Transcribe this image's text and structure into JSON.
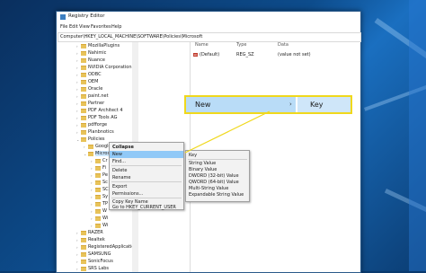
{
  "window": {
    "title": "Registry Editor"
  },
  "menu": [
    "File",
    "Edit",
    "View",
    "Favorites",
    "Help"
  ],
  "address": "Computer\\HKEY_LOCAL_MACHINE\\SOFTWARE\\Policies\\Microsoft",
  "tree": [
    "MozillaPlugins",
    "Nahimic",
    "Nuance",
    "NVIDIA Corporation",
    "ODBC",
    "OEM",
    "Oracle",
    "paint.net",
    "Partner",
    "PDF Architect 4",
    "PDF Tools AG",
    "pdfforge",
    "Planbnotics",
    "Policies",
    "Google",
    "Microsoft"
  ],
  "tree_after": [
    "RAZER",
    "Realtek",
    "RegisteredApplication",
    "SAMSUNG",
    "SonicFocus",
    "SRS Labs"
  ],
  "tree_children_partial": [
    "Cr",
    "Fi",
    "Pe",
    "Sc",
    "SC",
    "Sy",
    "TP",
    "W",
    "Wi",
    "Wi"
  ],
  "columns": {
    "name": "Name",
    "type": "Type",
    "data": "Data"
  },
  "values": [
    {
      "name": "(Default)",
      "type": "REG_SZ",
      "data": "(value not set)"
    }
  ],
  "context_menu": [
    "Collapse",
    "New",
    "Find...",
    "Delete",
    "Rename",
    "Export",
    "Permissions...",
    "Copy Key Name",
    "Go to HKEY_CURRENT_USER"
  ],
  "submenu": [
    "Key",
    "String Value",
    "Binary Value",
    "DWORD (32-bit) Value",
    "QWORD (64-bit) Value",
    "Multi-String Value",
    "Expandable String Value"
  ],
  "callout": {
    "new": "New",
    "arrow": "›",
    "key": "Key"
  },
  "colors": {
    "highlight": "#91c9f7",
    "callout_border": "#f0d81c",
    "folder": "#e8c35a"
  }
}
